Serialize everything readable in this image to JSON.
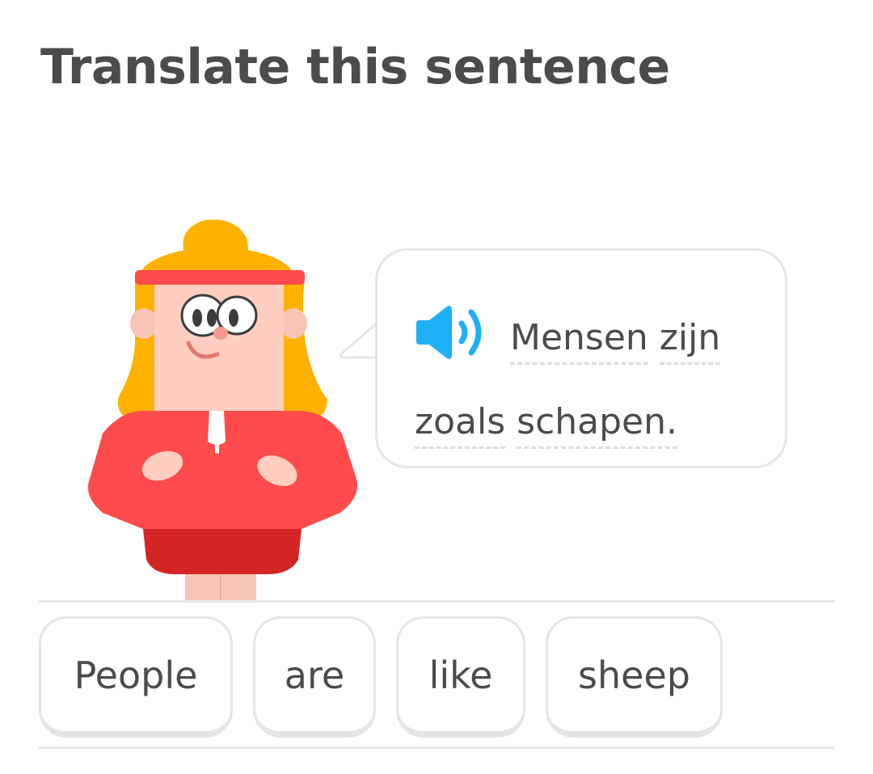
{
  "header": {
    "title": "Translate this sentence"
  },
  "character": {
    "name": "female-character-red-outfit"
  },
  "prompt": {
    "speaker_icon": "speaker-icon",
    "words": [
      "Mensen",
      "zijn",
      "zoals",
      "schapen."
    ]
  },
  "word_bank": {
    "tiles": [
      "People",
      "are",
      "like",
      "sheep"
    ]
  },
  "colors": {
    "title_text": "#4b4b4b",
    "border": "#e5e5e5",
    "speaker_blue": "#1cb0f6",
    "outfit_red": "#ff4b4b",
    "hair_yellow": "#ffb100"
  }
}
